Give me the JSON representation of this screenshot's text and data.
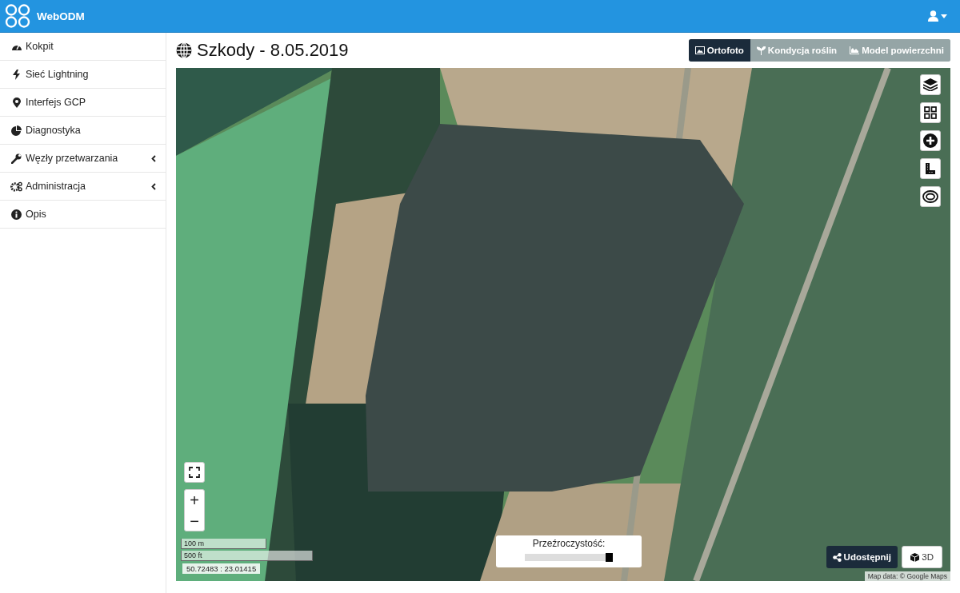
{
  "navbar": {
    "brand": "WebODM"
  },
  "sidebar": {
    "items": [
      {
        "label": "Kokpit",
        "expandable": false
      },
      {
        "label": "Sieć Lightning",
        "expandable": false
      },
      {
        "label": "Interfejs GCP",
        "expandable": false
      },
      {
        "label": "Diagnostyka",
        "expandable": false
      },
      {
        "label": "Węzły przetwarzania",
        "expandable": true
      },
      {
        "label": "Administracja",
        "expandable": true
      },
      {
        "label": "Opis",
        "expandable": false
      }
    ]
  },
  "page": {
    "title": "Szkody - 8.05.2019"
  },
  "view_tabs": [
    {
      "label": "Ortofoto",
      "selected": true
    },
    {
      "label": "Kondycja roślin",
      "selected": false
    },
    {
      "label": "Model powierzchni",
      "selected": false
    }
  ],
  "map": {
    "zoom_in": "+",
    "zoom_out": "−",
    "scale": [
      "100 m",
      "500 ft"
    ],
    "coordinates": "50.72483 : 23.01415",
    "opacity": {
      "label": "Przeźroczystość:",
      "level": 1
    },
    "share_button": "Udostępnij",
    "view_3d_button": "3D",
    "attribution": "Map data: © Google Maps"
  }
}
